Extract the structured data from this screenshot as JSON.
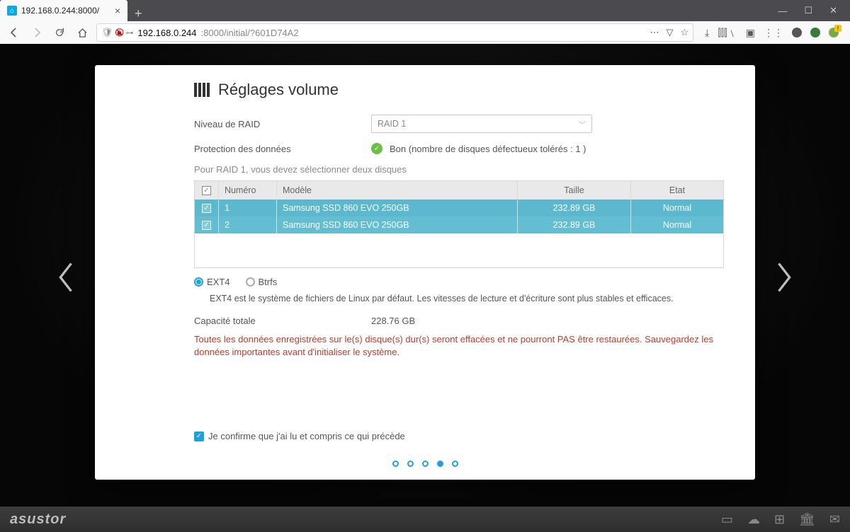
{
  "browser": {
    "tab_title": "192.168.0.244:8000/",
    "url_display_prefix": "192.168.0.244",
    "url_display_suffix": ":8000/initial/?601D74A2"
  },
  "dialog": {
    "title": "Réglages volume",
    "raid_label": "Niveau de RAID",
    "raid_value": "RAID 1",
    "protection_label": "Protection des données",
    "protection_value": "Bon (nombre de disques défectueux tolérés : 1 )",
    "hint": "Pour RAID 1, vous devez sélectionner deux disques",
    "table": {
      "headers": {
        "num": "Numéro",
        "model": "Modèle",
        "size": "Taille",
        "state": "Etat"
      },
      "rows": [
        {
          "num": "1",
          "model": "Samsung SSD 860 EVO 250GB",
          "size": "232.89 GB",
          "state": "Normal"
        },
        {
          "num": "2",
          "model": "Samsung SSD 860 EVO 250GB",
          "size": "232.89 GB",
          "state": "Normal"
        }
      ]
    },
    "fs": {
      "ext4": "EXT4",
      "btrfs": "Btrfs",
      "desc": "EXT4 est le système de fichiers de Linux par défaut. Les vitesses de lecture et d'écriture sont plus stables et efficaces."
    },
    "capacity_label": "Capacité totale",
    "capacity_value": "228.76 GB",
    "warning": "Toutes les données enregistrées sur le(s) disque(s) dur(s) seront effacées et ne pourront PAS être restaurées. Sauvegardez les données importantes avant d'initialiser le système.",
    "confirm": "Je confirme que j'ai lu et compris ce qui précède"
  },
  "footer": {
    "brand": "asustor"
  }
}
